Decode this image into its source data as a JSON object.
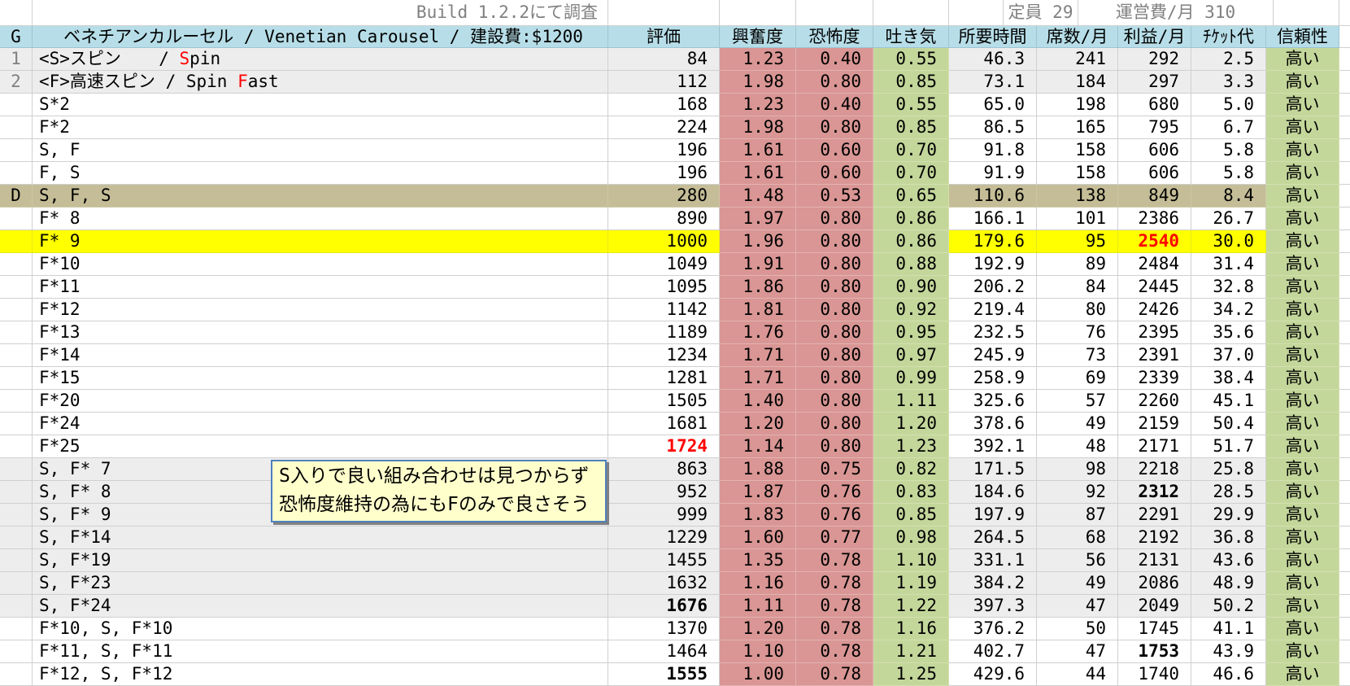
{
  "meta": {
    "build_note": "Build 1.2.2にて調査",
    "capacity_label": "定員 29",
    "operating_cost_label": "運営費/月 310"
  },
  "header": {
    "g": "G",
    "ride_title": "ベネチアンカルーセル / Venetian Carousel / 建設費:$1200",
    "columns": [
      "評価",
      "興奮度",
      "恐怖度",
      "吐き気",
      "所要時間",
      "席数/月",
      "利益/月",
      "ﾁｹｯﾄ代",
      "信頼性"
    ]
  },
  "note_box": {
    "lines": [
      "S入りで良い組み合わせは見つからず",
      "恐怖度維持の為にもFのみで良さそう"
    ]
  },
  "colors": {
    "header_blue": "#B7DEE8",
    "excitement_fear_pink": "#D99694",
    "nausea_reliability_green": "#C4D79B",
    "selected_row_tan": "#C4BD97",
    "highlight_row_yellow": "#FFFF00",
    "alt_row_gray": "#EDEDED",
    "warning_red": "#FF0000",
    "muted_gray": "#808080",
    "note_bg": "#FFFFCC",
    "note_border": "#4F81BD"
  },
  "rows": [
    {
      "g": "1",
      "g_gray": true,
      "bg": "gray",
      "label": [
        {
          "text": "<S>スピン　  / ",
          "red": false
        },
        {
          "text": "S",
          "red": true
        },
        {
          "text": "pin",
          "red": false
        }
      ],
      "rating": "84",
      "rating_style": "normal",
      "excitement": "1.23",
      "fear": "0.40",
      "nausea": "0.55",
      "time": "46.3",
      "seats": "241",
      "profit": "292",
      "profit_style": "normal",
      "ticket": "2.5",
      "reliability": "高い"
    },
    {
      "g": "2",
      "g_gray": true,
      "bg": "gray",
      "label": [
        {
          "text": "<F>高速スピン / Spin ",
          "red": false
        },
        {
          "text": "F",
          "red": true
        },
        {
          "text": "ast",
          "red": false
        }
      ],
      "rating": "112",
      "rating_style": "normal",
      "excitement": "1.98",
      "fear": "0.80",
      "nausea": "0.85",
      "time": "73.1",
      "seats": "184",
      "profit": "297",
      "profit_style": "normal",
      "ticket": "3.3",
      "reliability": "高い"
    },
    {
      "g": "",
      "g_gray": false,
      "bg": "white",
      "label": [
        {
          "text": "S*2",
          "red": false
        }
      ],
      "rating": "168",
      "rating_style": "normal",
      "excitement": "1.23",
      "fear": "0.40",
      "nausea": "0.55",
      "time": "65.0",
      "seats": "198",
      "profit": "680",
      "profit_style": "normal",
      "ticket": "5.0",
      "reliability": "高い"
    },
    {
      "g": "",
      "g_gray": false,
      "bg": "white",
      "label": [
        {
          "text": "F*2",
          "red": false
        }
      ],
      "rating": "224",
      "rating_style": "normal",
      "excitement": "1.98",
      "fear": "0.80",
      "nausea": "0.85",
      "time": "86.5",
      "seats": "165",
      "profit": "795",
      "profit_style": "normal",
      "ticket": "6.7",
      "reliability": "高い"
    },
    {
      "g": "",
      "g_gray": false,
      "bg": "white",
      "label": [
        {
          "text": "S, F",
          "red": false
        }
      ],
      "rating": "196",
      "rating_style": "normal",
      "excitement": "1.61",
      "fear": "0.60",
      "nausea": "0.70",
      "time": "91.8",
      "seats": "158",
      "profit": "606",
      "profit_style": "normal",
      "ticket": "5.8",
      "reliability": "高い"
    },
    {
      "g": "",
      "g_gray": false,
      "bg": "white",
      "label": [
        {
          "text": "F, S",
          "red": false
        }
      ],
      "rating": "196",
      "rating_style": "normal",
      "excitement": "1.61",
      "fear": "0.60",
      "nausea": "0.70",
      "time": "91.9",
      "seats": "158",
      "profit": "606",
      "profit_style": "normal",
      "ticket": "5.8",
      "reliability": "高い"
    },
    {
      "g": "D",
      "g_gray": false,
      "bg": "tan",
      "label": [
        {
          "text": "S, F, S",
          "red": false
        }
      ],
      "rating": "280",
      "rating_style": "normal",
      "excitement": "1.48",
      "fear": "0.53",
      "nausea": "0.65",
      "time": "110.6",
      "seats": "138",
      "profit": "849",
      "profit_style": "normal",
      "ticket": "8.4",
      "reliability": "高い"
    },
    {
      "g": "",
      "g_gray": false,
      "bg": "white",
      "label": [
        {
          "text": "F* 8",
          "red": false
        }
      ],
      "rating": "890",
      "rating_style": "normal",
      "excitement": "1.97",
      "fear": "0.80",
      "nausea": "0.86",
      "time": "166.1",
      "seats": "101",
      "profit": "2386",
      "profit_style": "normal",
      "ticket": "26.7",
      "reliability": "高い"
    },
    {
      "g": "",
      "g_gray": false,
      "bg": "yellow",
      "label": [
        {
          "text": "F* 9",
          "red": false
        }
      ],
      "rating": "1000",
      "rating_style": "normal",
      "excitement": "1.96",
      "fear": "0.80",
      "nausea": "0.86",
      "time": "179.6",
      "seats": "95",
      "profit": "2540",
      "profit_style": "red",
      "ticket": "30.0",
      "reliability": "高い"
    },
    {
      "g": "",
      "g_gray": false,
      "bg": "white",
      "label": [
        {
          "text": "F*10",
          "red": false
        }
      ],
      "rating": "1049",
      "rating_style": "normal",
      "excitement": "1.91",
      "fear": "0.80",
      "nausea": "0.88",
      "time": "192.9",
      "seats": "89",
      "profit": "2484",
      "profit_style": "normal",
      "ticket": "31.4",
      "reliability": "高い"
    },
    {
      "g": "",
      "g_gray": false,
      "bg": "white",
      "label": [
        {
          "text": "F*11",
          "red": false
        }
      ],
      "rating": "1095",
      "rating_style": "normal",
      "excitement": "1.86",
      "fear": "0.80",
      "nausea": "0.90",
      "time": "206.2",
      "seats": "84",
      "profit": "2445",
      "profit_style": "normal",
      "ticket": "32.8",
      "reliability": "高い"
    },
    {
      "g": "",
      "g_gray": false,
      "bg": "white",
      "label": [
        {
          "text": "F*12",
          "red": false
        }
      ],
      "rating": "1142",
      "rating_style": "normal",
      "excitement": "1.81",
      "fear": "0.80",
      "nausea": "0.92",
      "time": "219.4",
      "seats": "80",
      "profit": "2426",
      "profit_style": "normal",
      "ticket": "34.2",
      "reliability": "高い"
    },
    {
      "g": "",
      "g_gray": false,
      "bg": "white",
      "label": [
        {
          "text": "F*13",
          "red": false
        }
      ],
      "rating": "1189",
      "rating_style": "normal",
      "excitement": "1.76",
      "fear": "0.80",
      "nausea": "0.95",
      "time": "232.5",
      "seats": "76",
      "profit": "2395",
      "profit_style": "normal",
      "ticket": "35.6",
      "reliability": "高い"
    },
    {
      "g": "",
      "g_gray": false,
      "bg": "white",
      "label": [
        {
          "text": "F*14",
          "red": false
        }
      ],
      "rating": "1234",
      "rating_style": "normal",
      "excitement": "1.71",
      "fear": "0.80",
      "nausea": "0.97",
      "time": "245.9",
      "seats": "73",
      "profit": "2391",
      "profit_style": "normal",
      "ticket": "37.0",
      "reliability": "高い"
    },
    {
      "g": "",
      "g_gray": false,
      "bg": "white",
      "label": [
        {
          "text": "F*15",
          "red": false
        }
      ],
      "rating": "1281",
      "rating_style": "normal",
      "excitement": "1.71",
      "fear": "0.80",
      "nausea": "0.99",
      "time": "258.9",
      "seats": "69",
      "profit": "2339",
      "profit_style": "normal",
      "ticket": "38.4",
      "reliability": "高い"
    },
    {
      "g": "",
      "g_gray": false,
      "bg": "white",
      "label": [
        {
          "text": "F*20",
          "red": false
        }
      ],
      "rating": "1505",
      "rating_style": "normal",
      "excitement": "1.40",
      "fear": "0.80",
      "nausea": "1.11",
      "time": "325.6",
      "seats": "57",
      "profit": "2260",
      "profit_style": "normal",
      "ticket": "45.1",
      "reliability": "高い"
    },
    {
      "g": "",
      "g_gray": false,
      "bg": "white",
      "label": [
        {
          "text": "F*24",
          "red": false
        }
      ],
      "rating": "1681",
      "rating_style": "normal",
      "excitement": "1.20",
      "fear": "0.80",
      "nausea": "1.20",
      "time": "378.6",
      "seats": "49",
      "profit": "2159",
      "profit_style": "normal",
      "ticket": "50.4",
      "reliability": "高い"
    },
    {
      "g": "",
      "g_gray": false,
      "bg": "white",
      "label": [
        {
          "text": "F*25",
          "red": false
        }
      ],
      "rating": "1724",
      "rating_style": "red",
      "excitement": "1.14",
      "fear": "0.80",
      "nausea": "1.23",
      "time": "392.1",
      "seats": "48",
      "profit": "2171",
      "profit_style": "normal",
      "ticket": "51.7",
      "reliability": "高い"
    },
    {
      "g": "",
      "g_gray": false,
      "bg": "gray",
      "label": [
        {
          "text": "S, F* 7",
          "red": false
        }
      ],
      "rating": "863",
      "rating_style": "normal",
      "excitement": "1.88",
      "fear": "0.75",
      "nausea": "0.82",
      "time": "171.5",
      "seats": "98",
      "profit": "2218",
      "profit_style": "normal",
      "ticket": "25.8",
      "reliability": "高い"
    },
    {
      "g": "",
      "g_gray": false,
      "bg": "gray",
      "label": [
        {
          "text": "S, F* 8",
          "red": false
        }
      ],
      "rating": "952",
      "rating_style": "normal",
      "excitement": "1.87",
      "fear": "0.76",
      "nausea": "0.83",
      "time": "184.6",
      "seats": "92",
      "profit": "2312",
      "profit_style": "bold",
      "ticket": "28.5",
      "reliability": "高い"
    },
    {
      "g": "",
      "g_gray": false,
      "bg": "gray",
      "label": [
        {
          "text": "S, F* 9",
          "red": false
        }
      ],
      "rating": "999",
      "rating_style": "normal",
      "excitement": "1.83",
      "fear": "0.76",
      "nausea": "0.85",
      "time": "197.9",
      "seats": "87",
      "profit": "2291",
      "profit_style": "normal",
      "ticket": "29.9",
      "reliability": "高い"
    },
    {
      "g": "",
      "g_gray": false,
      "bg": "gray",
      "label": [
        {
          "text": "S, F*14",
          "red": false
        }
      ],
      "rating": "1229",
      "rating_style": "normal",
      "excitement": "1.60",
      "fear": "0.77",
      "nausea": "0.98",
      "time": "264.5",
      "seats": "68",
      "profit": "2192",
      "profit_style": "normal",
      "ticket": "36.8",
      "reliability": "高い"
    },
    {
      "g": "",
      "g_gray": false,
      "bg": "gray",
      "label": [
        {
          "text": "S, F*19",
          "red": false
        }
      ],
      "rating": "1455",
      "rating_style": "normal",
      "excitement": "1.35",
      "fear": "0.78",
      "nausea": "1.10",
      "time": "331.1",
      "seats": "56",
      "profit": "2131",
      "profit_style": "normal",
      "ticket": "43.6",
      "reliability": "高い"
    },
    {
      "g": "",
      "g_gray": false,
      "bg": "gray",
      "label": [
        {
          "text": "S, F*23",
          "red": false
        }
      ],
      "rating": "1632",
      "rating_style": "normal",
      "excitement": "1.16",
      "fear": "0.78",
      "nausea": "1.19",
      "time": "384.2",
      "seats": "49",
      "profit": "2086",
      "profit_style": "normal",
      "ticket": "48.9",
      "reliability": "高い"
    },
    {
      "g": "",
      "g_gray": false,
      "bg": "gray",
      "label": [
        {
          "text": "S, F*24",
          "red": false
        }
      ],
      "rating": "1676",
      "rating_style": "bold",
      "excitement": "1.11",
      "fear": "0.78",
      "nausea": "1.22",
      "time": "397.3",
      "seats": "47",
      "profit": "2049",
      "profit_style": "normal",
      "ticket": "50.2",
      "reliability": "高い"
    },
    {
      "g": "",
      "g_gray": false,
      "bg": "white",
      "label": [
        {
          "text": "F*10, S, F*10",
          "red": false
        }
      ],
      "rating": "1370",
      "rating_style": "normal",
      "excitement": "1.20",
      "fear": "0.78",
      "nausea": "1.16",
      "time": "376.2",
      "seats": "50",
      "profit": "1745",
      "profit_style": "normal",
      "ticket": "41.1",
      "reliability": "高い"
    },
    {
      "g": "",
      "g_gray": false,
      "bg": "white",
      "label": [
        {
          "text": "F*11, S, F*11",
          "red": false
        }
      ],
      "rating": "1464",
      "rating_style": "normal",
      "excitement": "1.10",
      "fear": "0.78",
      "nausea": "1.21",
      "time": "402.7",
      "seats": "47",
      "profit": "1753",
      "profit_style": "bold",
      "ticket": "43.9",
      "reliability": "高い"
    },
    {
      "g": "",
      "g_gray": false,
      "bg": "white",
      "label": [
        {
          "text": "F*12, S, F*12",
          "red": false
        }
      ],
      "rating": "1555",
      "rating_style": "bold",
      "excitement": "1.00",
      "fear": "0.78",
      "nausea": "1.25",
      "time": "429.6",
      "seats": "44",
      "profit": "1740",
      "profit_style": "normal",
      "ticket": "46.6",
      "reliability": "高い"
    }
  ]
}
